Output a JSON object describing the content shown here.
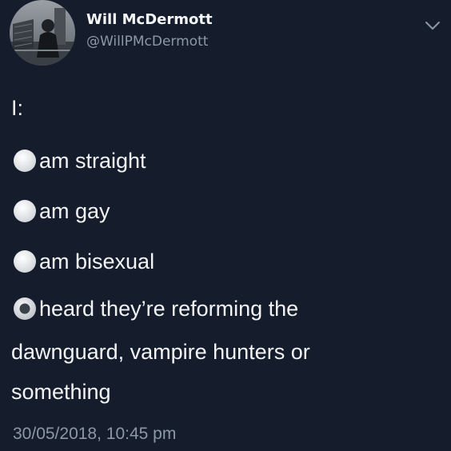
{
  "tweet": {
    "author": {
      "display_name": "Will McDermott",
      "handle": "@WillPMcDermott"
    },
    "lead_text": "I:",
    "options": [
      {
        "label": "am straight",
        "selected": false
      },
      {
        "label": "am gay",
        "selected": false
      },
      {
        "label": "am bisexual",
        "selected": false
      },
      {
        "label": "heard they’re reforming the",
        "selected": true
      }
    ],
    "option_continuation": [
      "dawnguard, vampire hunters or",
      "something"
    ],
    "timestamp": "30/05/2018, 10:45 pm",
    "colors": {
      "background": "#151d2c",
      "text": "#f2f4f6",
      "secondary_text": "#8b98a5"
    },
    "icons": {
      "menu": "chevron-down-icon",
      "radio": "radio-button-icon"
    }
  }
}
